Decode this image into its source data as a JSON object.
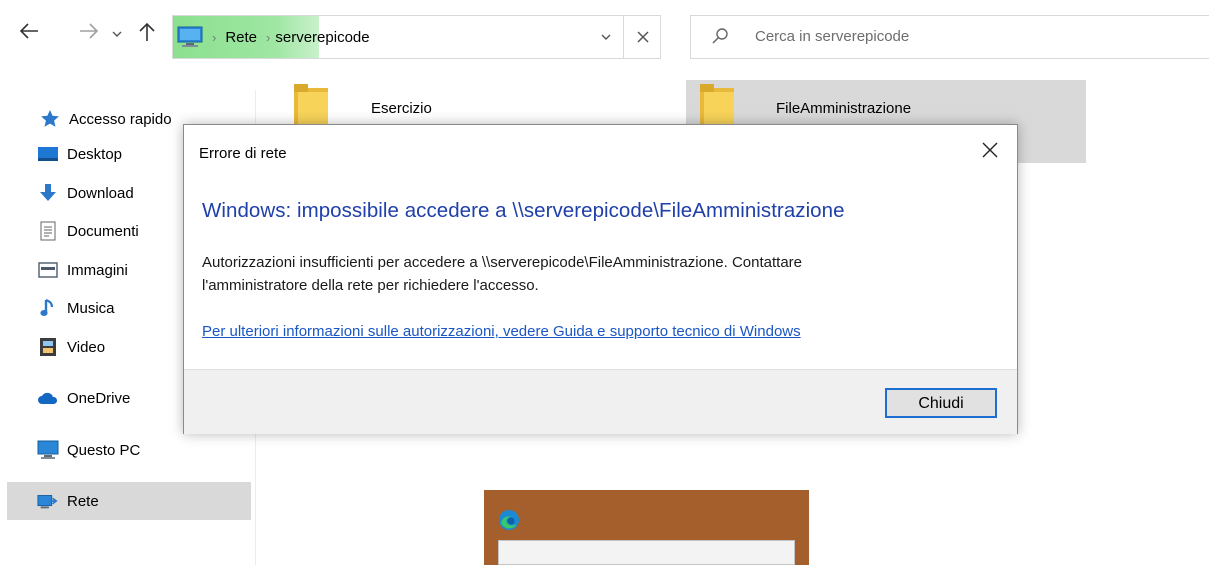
{
  "nav": {
    "back_icon": "arrow-left-icon",
    "forward_icon": "arrow-right-icon",
    "recent_icon": "chevron-down-icon",
    "up_icon": "arrow-up-icon"
  },
  "address": {
    "breadcrumbs": [
      "Rete",
      "serverepicode"
    ],
    "progress_percent": 30,
    "dropdown_icon": "chevron-down-icon",
    "clear_icon": "close-icon"
  },
  "search": {
    "placeholder": "Cerca in serverepicode"
  },
  "sidebar": {
    "items": [
      {
        "label": "Accesso rapido",
        "icon": "star-icon"
      },
      {
        "label": "Desktop",
        "icon": "desktop-icon"
      },
      {
        "label": "Download",
        "icon": "download-icon"
      },
      {
        "label": "Documenti",
        "icon": "document-icon"
      },
      {
        "label": "Immagini",
        "icon": "pictures-icon"
      },
      {
        "label": "Musica",
        "icon": "music-icon"
      },
      {
        "label": "Video",
        "icon": "video-icon"
      },
      {
        "label": "OneDrive",
        "icon": "cloud-icon"
      },
      {
        "label": "Questo PC",
        "icon": "computer-icon"
      },
      {
        "label": "Rete",
        "icon": "network-icon",
        "selected": true
      }
    ]
  },
  "folders": [
    {
      "label": "Esercizio",
      "icon": "folder-icon"
    },
    {
      "label": "FileAmministrazione",
      "icon": "folder-icon",
      "selected": true
    }
  ],
  "dialog": {
    "title": "Errore di rete",
    "heading": "Windows: impossibile accedere a \\\\serverepicode\\FileAmministrazione",
    "message_line1": "Autorizzazioni insufficienti per accedere a \\\\serverepicode\\FileAmministrazione. Contattare",
    "message_line2": "l'amministratore della rete per richiedere l'accesso.",
    "link": "Per ulteriori informazioni sulle autorizzazioni, vedere Guida e supporto tecnico di Windows",
    "close_button": "Chiudi"
  },
  "colors": {
    "heading": "#1f3faa",
    "link": "#1a56c4",
    "progress": "#8be08f",
    "selection": "#d9d9d9",
    "thumbnail_bg": "#a45f2c"
  }
}
